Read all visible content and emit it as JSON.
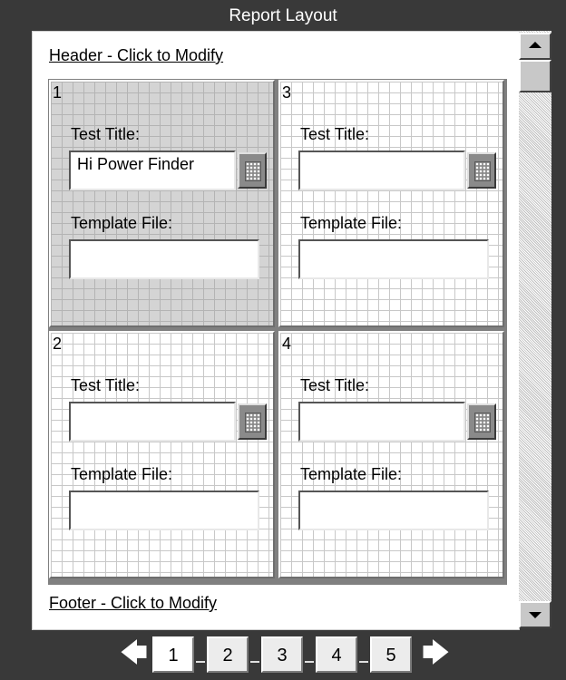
{
  "window": {
    "title": "Report Layout"
  },
  "header_link": "Header - Click to Modify",
  "footer_link": "Footer - Click to Modify",
  "cells": [
    {
      "number": "1",
      "title_label": "Test Title:",
      "title_value": "Hi Power Finder",
      "file_label": "Template File:",
      "file_value": "",
      "selected": true
    },
    {
      "number": "3",
      "title_label": "Test Title:",
      "title_value": "",
      "file_label": "Template File:",
      "file_value": "",
      "selected": false
    },
    {
      "number": "2",
      "title_label": "Test Title:",
      "title_value": "",
      "file_label": "Template File:",
      "file_value": "",
      "selected": false
    },
    {
      "number": "4",
      "title_label": "Test Title:",
      "title_value": "",
      "file_label": "Template File:",
      "file_value": "",
      "selected": false
    }
  ],
  "pager": {
    "prev_icon": "left-arrow-icon",
    "next_icon": "right-arrow-icon",
    "pages": [
      "1",
      "2",
      "3",
      "4",
      "5"
    ],
    "current": "1",
    "prev_glyph": "🡄",
    "next_glyph": "🡆"
  },
  "colors": {
    "background": "#393939",
    "selected_cell": "#d4d4d4",
    "grid_line": "#c8c8c8"
  }
}
